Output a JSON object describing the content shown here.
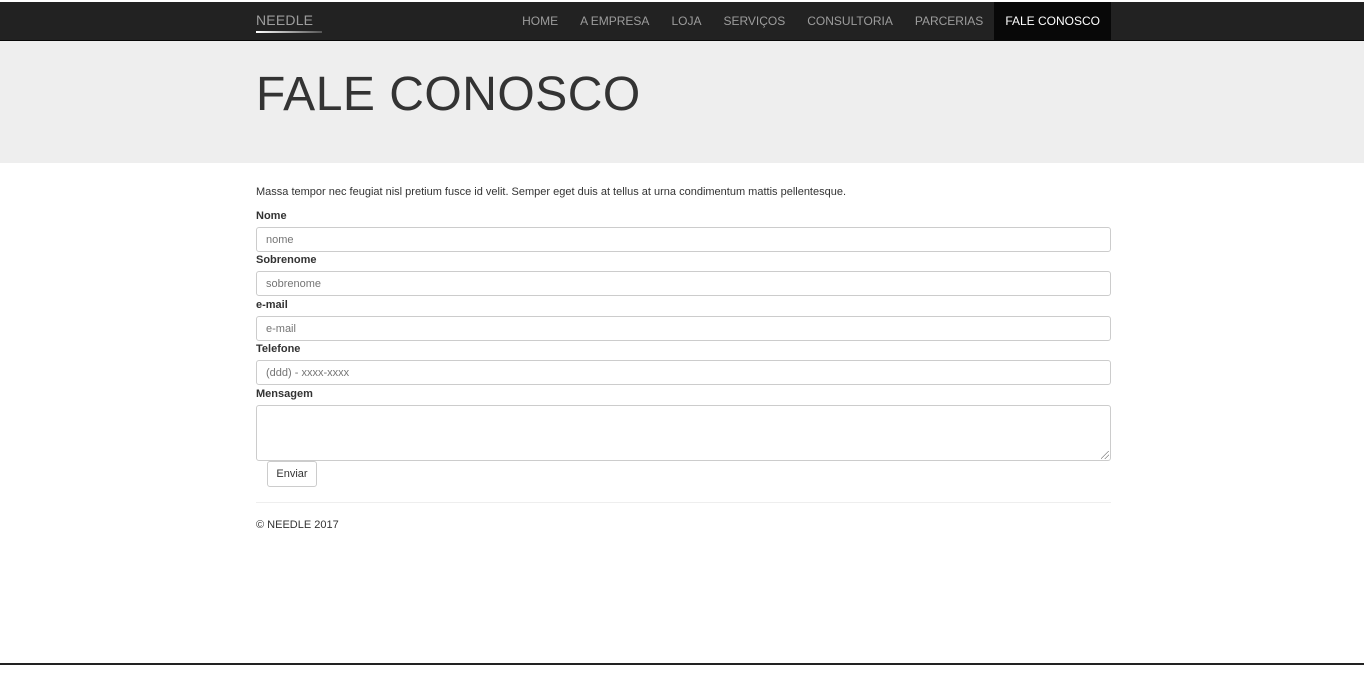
{
  "navbar": {
    "brand": "NEEDLE",
    "items": [
      {
        "label": "HOME"
      },
      {
        "label": "A EMPRESA"
      },
      {
        "label": "LOJA"
      },
      {
        "label": "SERVIÇOS"
      },
      {
        "label": "CONSULTORIA"
      },
      {
        "label": "PARCERIAS"
      },
      {
        "label": "FALE CONOSCO"
      }
    ],
    "active_item": "FALE CONOSCO"
  },
  "header": {
    "title": "FALE CONOSCO"
  },
  "form": {
    "intro": "Massa tempor nec feugiat nisl pretium fusce id velit. Semper eget duis at tellus at urna condimentum mattis pellentesque.",
    "nome": {
      "label": "Nome",
      "placeholder": "nome",
      "value": ""
    },
    "sobrenome": {
      "label": "Sobrenome",
      "placeholder": "sobrenome",
      "value": ""
    },
    "email": {
      "label": "e-mail",
      "placeholder": "e-mail",
      "value": ""
    },
    "telefone": {
      "label": "Telefone",
      "placeholder": "(ddd) - xxxx-xxxx",
      "value": ""
    },
    "mensagem": {
      "label": "Mensagem",
      "value": ""
    },
    "submit_label": "Enviar"
  },
  "footer": {
    "copyright": "© NEEDLE 2017"
  },
  "colors": {
    "navbar_bg": "#222222",
    "active_bg": "#080808",
    "jumbotron_bg": "#eeeeee"
  }
}
